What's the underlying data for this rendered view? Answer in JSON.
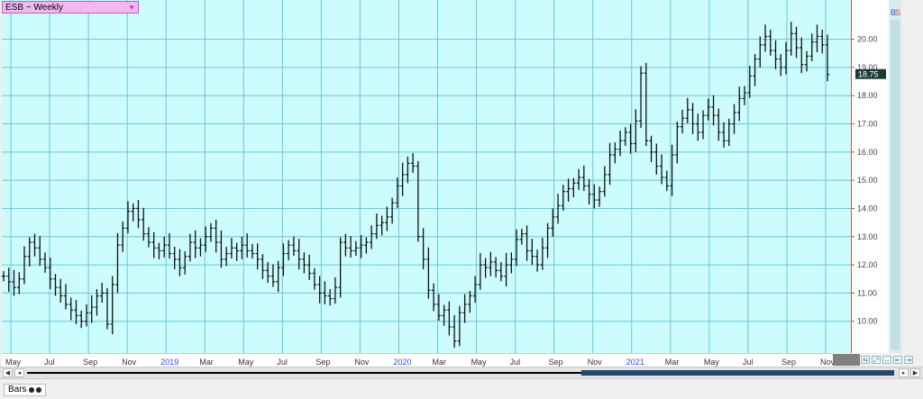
{
  "symbol": {
    "label": "ESB ~ Weekly",
    "dropdown_icon": "triangle-down-icon"
  },
  "colors": {
    "background": "#ccfcfc",
    "grid": "#6fc5d6",
    "bar": "#111111",
    "axis_line": "#e24a4a",
    "last_price_bg": "#1d3b36"
  },
  "indicators": {
    "buy": "B",
    "sell": "S"
  },
  "chart_data": {
    "type": "ohlc",
    "ylim": [
      9.0,
      21.2
    ],
    "yticks": [
      "20.00",
      "19.00",
      "18.00",
      "17.00",
      "16.00",
      "15.00",
      "14.00",
      "13.00",
      "12.00",
      "11.00",
      "10.00"
    ],
    "last_price": "18.75",
    "x_labels": [
      {
        "t": "May",
        "year": false
      },
      {
        "t": "Jul",
        "year": false
      },
      {
        "t": "Sep",
        "year": false
      },
      {
        "t": "Nov",
        "year": false
      },
      {
        "t": "2019",
        "year": true
      },
      {
        "t": "Mar",
        "year": false
      },
      {
        "t": "May",
        "year": false
      },
      {
        "t": "Jul",
        "year": false
      },
      {
        "t": "Sep",
        "year": false
      },
      {
        "t": "Nov",
        "year": false
      },
      {
        "t": "2020",
        "year": true
      },
      {
        "t": "Mar",
        "year": false
      },
      {
        "t": "May",
        "year": false
      },
      {
        "t": "Jul",
        "year": false
      },
      {
        "t": "Sep",
        "year": false
      },
      {
        "t": "Nov",
        "year": false
      },
      {
        "t": "2021",
        "year": true
      },
      {
        "t": "Mar",
        "year": false
      },
      {
        "t": "May",
        "year": false
      },
      {
        "t": "Jul",
        "year": false
      },
      {
        "t": "Sep",
        "year": false
      },
      {
        "t": "Nov",
        "year": false
      }
    ],
    "weekly_closes": [
      11.6,
      11.4,
      11.2,
      11.5,
      12.3,
      12.8,
      12.6,
      12.2,
      11.9,
      11.5,
      11.2,
      10.9,
      10.6,
      10.4,
      10.2,
      10.0,
      10.3,
      10.5,
      10.9,
      11.0,
      9.9,
      11.3,
      12.7,
      13.3,
      13.9,
      14.0,
      13.6,
      13.1,
      12.8,
      12.6,
      12.5,
      12.7,
      12.4,
      12.2,
      11.9,
      12.3,
      12.8,
      12.6,
      12.7,
      13.0,
      13.3,
      12.8,
      12.2,
      12.4,
      12.6,
      12.5,
      12.7,
      12.5,
      12.4,
      12.2,
      11.8,
      11.6,
      11.4,
      11.9,
      12.4,
      12.7,
      12.5,
      12.2,
      12.0,
      11.7,
      11.3,
      11.0,
      10.9,
      10.8,
      11.2,
      12.8,
      12.6,
      12.5,
      12.6,
      12.7,
      12.8,
      13.1,
      13.4,
      13.5,
      13.7,
      14.2,
      14.8,
      15.2,
      15.6,
      15.5,
      13.0,
      12.2,
      11.1,
      10.6,
      10.2,
      10.4,
      9.8,
      9.3,
      10.3,
      10.6,
      10.9,
      11.3,
      12.0,
      11.9,
      12.1,
      11.8,
      11.6,
      12.0,
      12.2,
      12.9,
      13.1,
      12.5,
      12.3,
      12.0,
      12.6,
      13.3,
      13.7,
      14.1,
      14.6,
      14.7,
      14.9,
      15.1,
      14.8,
      14.5,
      14.3,
      14.6,
      15.2,
      15.9,
      16.1,
      16.4,
      16.7,
      16.3,
      17.1,
      18.8,
      16.4,
      16.0,
      15.5,
      15.1,
      14.8,
      15.9,
      16.9,
      17.2,
      17.5,
      17.0,
      16.7,
      17.3,
      17.6,
      17.3,
      16.7,
      16.4,
      17.0,
      17.4,
      17.9,
      18.1,
      18.7,
      19.3,
      19.8,
      20.1,
      19.6,
      19.3,
      19.0,
      19.6,
      20.2,
      19.7,
      19.1,
      19.4,
      19.9,
      20.1,
      19.8,
      18.75
    ]
  }
}
